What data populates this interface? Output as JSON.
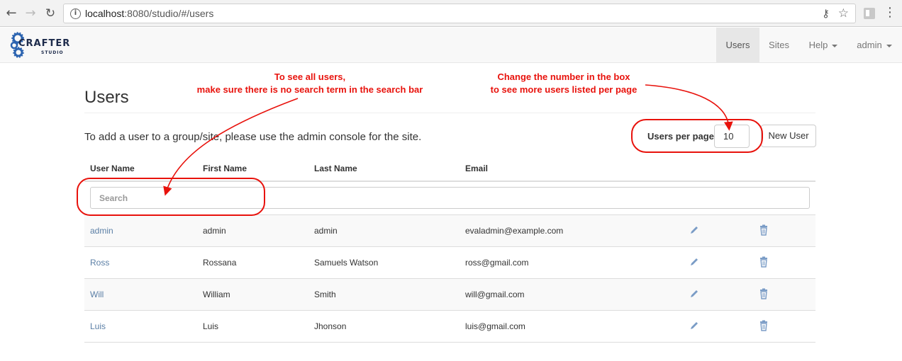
{
  "browser": {
    "url_host": "localhost",
    "url_rest": ":8080/studio/#/users"
  },
  "brand": {
    "title": "CRAFTER",
    "subtitle": "STUDIO"
  },
  "nav": {
    "users": "Users",
    "sites": "Sites",
    "help": "Help",
    "admin": "admin"
  },
  "page": {
    "title": "Users",
    "intro": "To add a user to a group/site, please use the admin console for the site.",
    "per_page_label": "Users per page:",
    "per_page_value": "10",
    "new_user_label": "New User",
    "search_placeholder": "Search"
  },
  "table": {
    "headers": [
      "User Name",
      "First Name",
      "Last Name",
      "Email"
    ],
    "rows": [
      {
        "username": "admin",
        "first": "admin",
        "last": "admin",
        "email": "evaladmin@example.com"
      },
      {
        "username": "Ross",
        "first": "Rossana",
        "last": "Samuels Watson",
        "email": "ross@gmail.com"
      },
      {
        "username": "Will",
        "first": "William",
        "last": "Smith",
        "email": "will@gmail.com"
      },
      {
        "username": "Luis",
        "first": "Luis",
        "last": "Jhonson",
        "email": "luis@gmail.com"
      }
    ]
  },
  "annotations": {
    "search_note_line1": "To see all users,",
    "search_note_line2": "make sure there is no search term in the search bar",
    "perpage_note_line1": "Change the number in the box",
    "perpage_note_line2": "to see more users listed per page"
  },
  "colors": {
    "annotation_red": "#e8120c",
    "link_blue": "#5b7fa6",
    "icon_blue": "#7a9cc6"
  },
  "icons": {
    "edit": "pencil-icon",
    "delete": "trash-icon"
  }
}
